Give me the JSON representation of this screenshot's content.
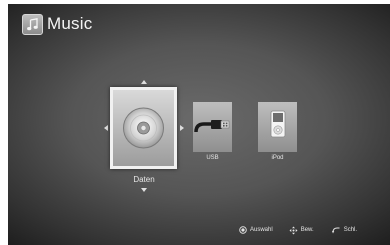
{
  "header": {
    "icon": "music-note-icon",
    "title": "Music"
  },
  "sources": [
    {
      "label": "Daten",
      "icon": "disc-icon",
      "selected": true
    },
    {
      "label": "USB",
      "icon": "usb-plug-icon",
      "selected": false
    },
    {
      "label": "iPod",
      "icon": "ipod-icon",
      "selected": false
    }
  ],
  "navigation": {
    "up": "arrow-up-icon",
    "down": "arrow-down-icon",
    "left": "arrow-left-icon",
    "right": "arrow-right-icon"
  },
  "footer": {
    "select": {
      "icon": "enter-button-icon",
      "label": "Auswahl"
    },
    "move": {
      "icon": "direction-pad-icon",
      "label": "Bew."
    },
    "close": {
      "icon": "return-icon",
      "label": "Schl."
    }
  }
}
